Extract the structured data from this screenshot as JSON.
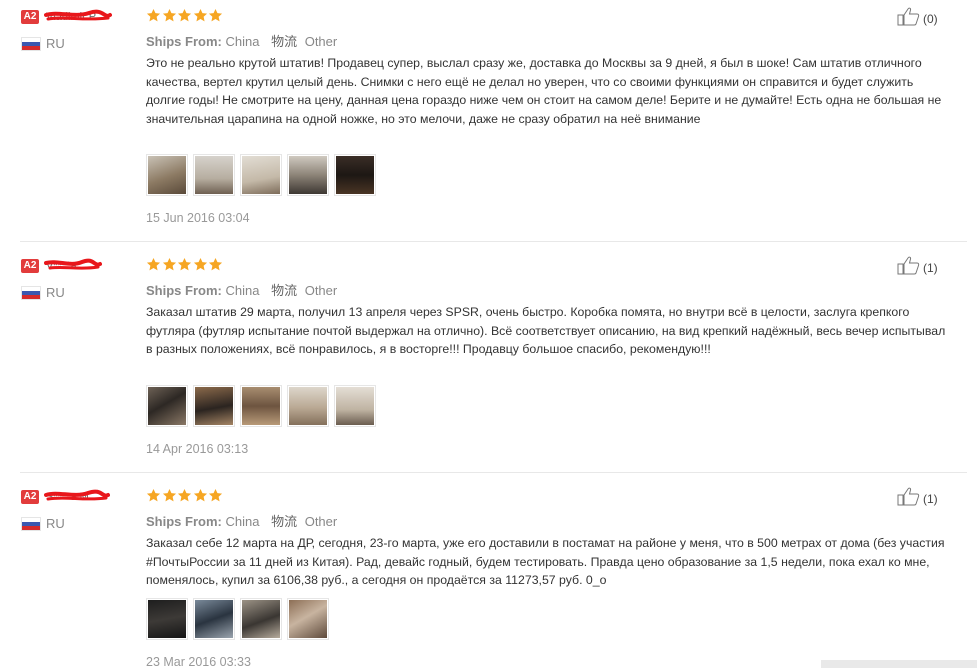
{
  "colors": {
    "star": "#f6a623",
    "badge": "#e23c3c",
    "scribble": "#e8171b"
  },
  "labels": {
    "ships_from": "Ships From:",
    "logistics": "物流"
  },
  "reviews": [
    {
      "badge": "A2",
      "username": "Vladimir P.",
      "country": "RU",
      "stars": 5,
      "ships_from": "China",
      "logistics": "Other",
      "text": "Это не реально крутой штатив! Продавец супер, выслал сразу же, доставка до Москвы за 9 дней, я был в шоке! Сам штатив отличного качества, вертел крутил целый день. Снимки с него ещё не делал но уверен, что со своими функциями он справится и будет служить долгие годы! Не смотрите на цену, данная цена гораздо ниже чем он стоит на самом деле! Берите и не думайте! Есть одна не большая не значительная царапина на одной ножке, но это мелочи, даже не сразу обратил на неё внимание",
      "photos": 5,
      "date": "15 Jun 2016 03:04",
      "helpful": "(0)"
    },
    {
      "badge": "A2",
      "username": "V****a",
      "country": "RU",
      "stars": 5,
      "ships_from": "China",
      "logistics": "Other",
      "text": "Заказал штатив 29 марта, получил 13 апреля через SPSR, очень быстро. Коробка помята, но внутри всё в целости, заслуга крепкого футляра (футляр испытание почтой выдержал на отлично). Всё соответствует описанию, на вид крепкий надёжный, весь вечер испытывал в разных положениях, всё понравилось, я в восторге!!! Продавцу большое спасибо, рекомендую!!!",
      "photos": 5,
      "date": "14 Apr 2016 03:13",
      "helpful": "(1)"
    },
    {
      "badge": "A2",
      "username": "S****a M.",
      "country": "RU",
      "stars": 5,
      "ships_from": "China",
      "logistics": "Other",
      "text": "Заказал себе 12 марта на ДР, сегодня, 23-го марта, уже его доставили в постамат на районе у меня, что в 500 метрах от дома (без участия #ПочтыРоссии за 11 дней из Китая). Рад, девайс годный, будем тестировать. Правда цено образование за 1,5 недели, пока ехал ко мне, поменялось, купил за 6106,38 руб., а сегодня он продаётся за 11273,57 руб. 0_о",
      "photos": 4,
      "date": "23 Mar 2016 03:33",
      "helpful": "(1)"
    }
  ]
}
